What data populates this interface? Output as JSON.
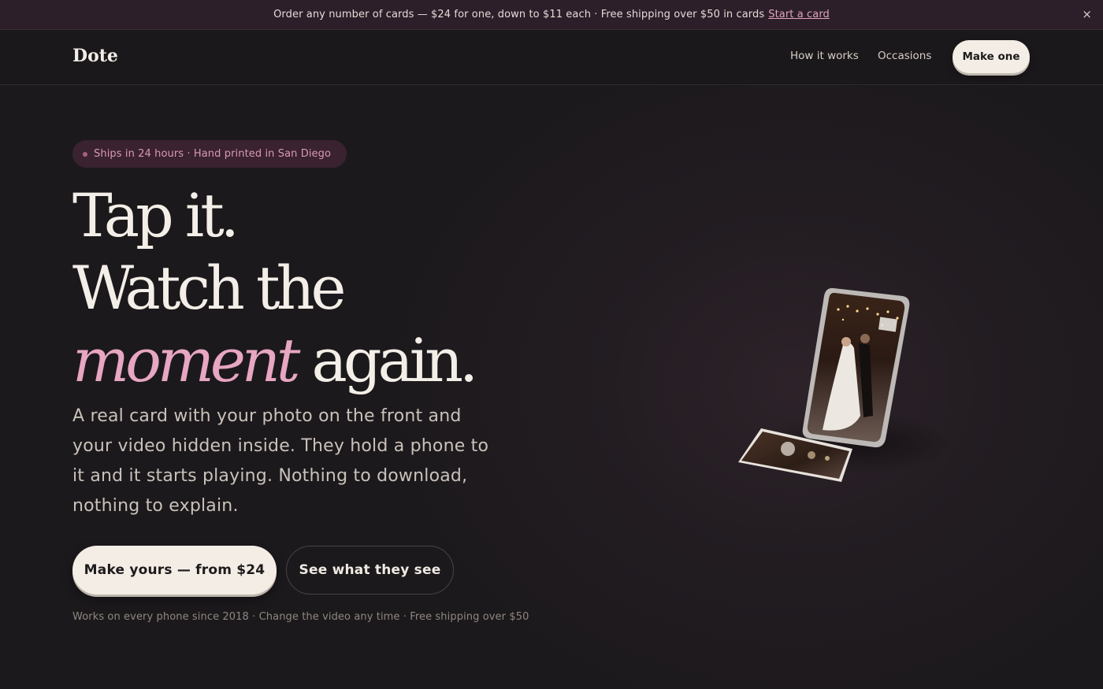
{
  "announcement": {
    "text": "Order any number of cards — $24 for one, down to $11 each · Free shipping over $50 in cards",
    "link": "Start a card",
    "close": "×"
  },
  "nav": {
    "brand": "Dote",
    "links": [
      "How it works",
      "Occasions"
    ],
    "cta": "Make one"
  },
  "hero": {
    "badge": "Ships in 24 hours · Hand printed in San Diego",
    "headline_line1": "Tap it.",
    "headline_line2": "Watch the",
    "headline_accent": "moment",
    "headline_line3_rest": "again.",
    "lede": "A real card with your photo on the front and your video hidden inside. They hold a phone to it and it starts playing. Nothing to download, nothing to explain.",
    "primary_button": "Make yours — from $24",
    "secondary_button": "See what they see",
    "fineprint": "Works on every phone since 2018 · Change the video any time · Free shipping over $50"
  },
  "colors": {
    "background": "#1c191c",
    "announcement_bg": "#2c1f2a",
    "accent_pink": "#e7a6c2",
    "button_cream": "#f3ede5"
  },
  "icons": {
    "close": "close-icon",
    "badge_dot": "dot-icon"
  }
}
